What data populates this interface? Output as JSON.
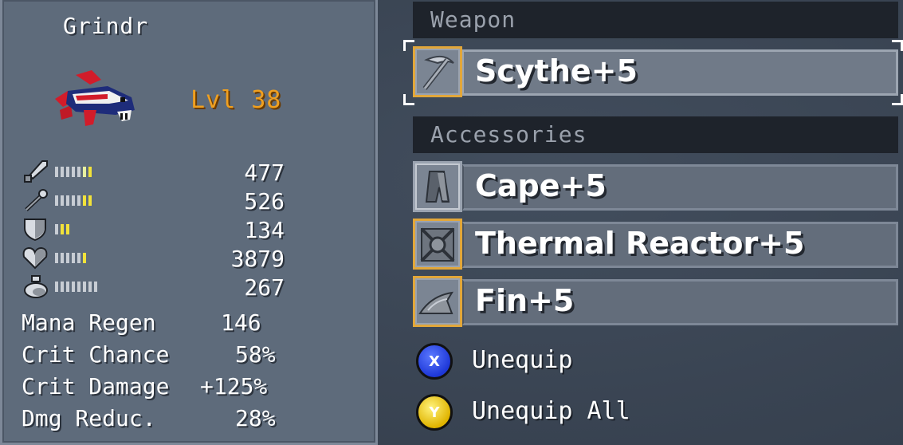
{
  "character": {
    "name": "Grindr",
    "level": "Lvl 38"
  },
  "stats": [
    {
      "icon": "sword-icon",
      "value": "477",
      "bars": [
        "w",
        "w",
        "w",
        "w",
        "w",
        "ly",
        "y"
      ]
    },
    {
      "icon": "wand-icon",
      "value": "526",
      "bars": [
        "w",
        "w",
        "w",
        "w",
        "w",
        "y",
        "y"
      ]
    },
    {
      "icon": "shield-icon",
      "value": "134",
      "bars": [
        "w",
        "y",
        "y"
      ]
    },
    {
      "icon": "heart-icon",
      "value": "3879",
      "bars": [
        "w",
        "w",
        "w",
        "w",
        "w",
        "y"
      ]
    },
    {
      "icon": "mana-flask-icon",
      "value": "267",
      "bars": [
        "w",
        "w",
        "w",
        "w",
        "w",
        "w",
        "w",
        "w"
      ]
    }
  ],
  "secondary_stats": [
    {
      "label": "Mana Regen",
      "value": "146"
    },
    {
      "label": "Crit Chance",
      "value": "58%"
    },
    {
      "label": "Crit Damage",
      "value": "+125%"
    },
    {
      "label": "Dmg Reduc.",
      "value": "28%"
    }
  ],
  "equipment": {
    "weapon_header": "Weapon",
    "accessories_header": "Accessories",
    "weapon": {
      "name": "Scythe+5",
      "icon": "scythe-icon"
    },
    "accessories": [
      {
        "name": "Cape+5",
        "icon": "cape-icon"
      },
      {
        "name": "Thermal Reactor+5",
        "icon": "reactor-icon"
      },
      {
        "name": "Fin+5",
        "icon": "fin-icon"
      }
    ]
  },
  "actions": [
    {
      "button": "X",
      "label": "Unequip",
      "color": "#2f4cf0"
    },
    {
      "button": "Y",
      "label": "Unequip All",
      "color": "#f0c800"
    }
  ],
  "colors": {
    "level": "#f0a020",
    "selected_border": "#e2a73a",
    "header_bg": "#1e232b"
  }
}
